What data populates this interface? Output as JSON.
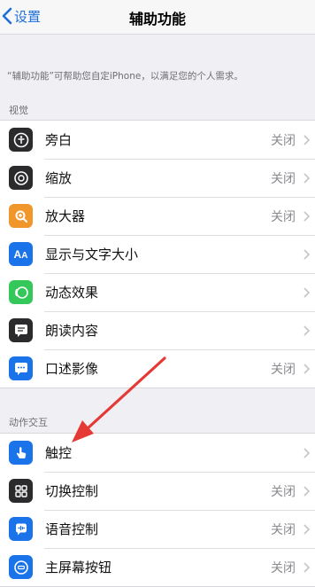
{
  "nav": {
    "back_label": "设置",
    "title": "辅助功能"
  },
  "description": "“辅助功能”可帮助您自定iPhone，以满足您的个人需求。",
  "sections": [
    {
      "header": "视觉",
      "rows": [
        {
          "label": "旁白",
          "value": "关闭",
          "icon": "voiceover-icon",
          "color": "#2b2b2e"
        },
        {
          "label": "缩放",
          "value": "关闭",
          "icon": "zoom-icon",
          "color": "#2b2b2e"
        },
        {
          "label": "放大器",
          "value": "关闭",
          "icon": "magnifier-icon",
          "color": "#f0962a"
        },
        {
          "label": "显示与文字大小",
          "value": "",
          "icon": "display-text-size-icon",
          "color": "#1a73e8"
        },
        {
          "label": "动态效果",
          "value": "",
          "icon": "motion-icon",
          "color": "#34c759"
        },
        {
          "label": "朗读内容",
          "value": "",
          "icon": "spoken-content-icon",
          "color": "#2b2b2e"
        },
        {
          "label": "口述影像",
          "value": "关闭",
          "icon": "audio-description-icon",
          "color": "#1a73e8"
        }
      ]
    },
    {
      "header": "动作交互",
      "rows": [
        {
          "label": "触控",
          "value": "",
          "icon": "touch-icon",
          "color": "#1a73e8"
        },
        {
          "label": "切换控制",
          "value": "关闭",
          "icon": "switch-control-icon",
          "color": "#2b2b2e"
        },
        {
          "label": "语音控制",
          "value": "关闭",
          "icon": "voice-control-icon",
          "color": "#1a73e8"
        },
        {
          "label": "主屏幕按钮",
          "value": "关闭",
          "icon": "home-button-icon",
          "color": "#1a73e8"
        }
      ]
    }
  ],
  "colors": {
    "accent": "#1e6fd9",
    "annotation_arrow": "#e53935"
  }
}
